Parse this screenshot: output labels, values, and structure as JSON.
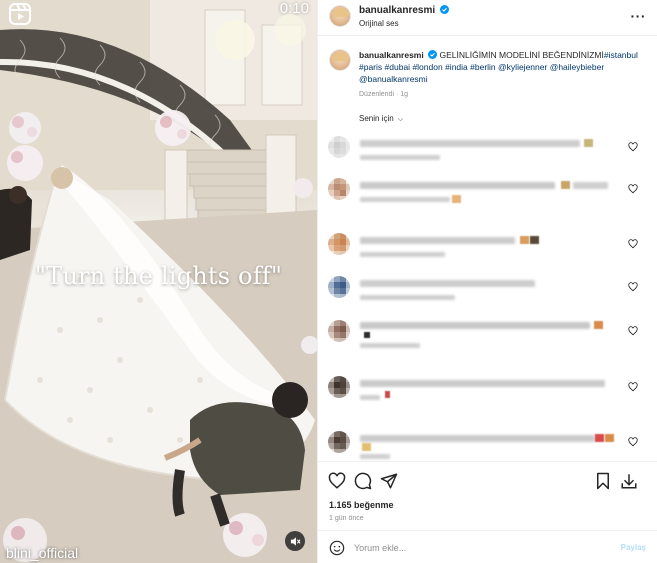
{
  "video": {
    "timer": "0:10",
    "overlay_caption": "\"Turn the lights off\"",
    "watermark": "blini_official",
    "icons": {
      "reels": "reels-icon",
      "mute": "speaker-muted-icon"
    }
  },
  "post_header": {
    "username": "banualkanresmi",
    "verified": true,
    "subtitle": "Orijinal ses",
    "more_icon": "more-horizontal-icon"
  },
  "caption": {
    "username": "banualkanresmi",
    "text": "GELİNLİĞİMİN MODELİNİ BEĞENDİNİZMİ",
    "hashtags": [
      "#istanbul",
      "#paris",
      "#dubai",
      "#london",
      "#india",
      "#berlin"
    ],
    "mentions": [
      "@kyliejenner",
      "@haileybieber",
      "@banualkanresmi"
    ],
    "time": "Düzenlendi · 1g"
  },
  "comment_filter": {
    "label": "Senin için"
  },
  "actions": {
    "like_icon": "heart-icon",
    "comment_icon": "comment-icon",
    "share_icon": "send-icon",
    "save_icon": "bookmark-icon",
    "download_icon": "download-icon"
  },
  "likes": "1.165 beğenme",
  "posted_ago": "1 gün önce",
  "add_comment": {
    "placeholder": "Yorum ekle...",
    "post_label": "Paylaş",
    "emoji_icon": "smiley-icon"
  },
  "colors": {
    "link": "#00376b",
    "verified": "#0095f6",
    "post_disabled": "#b2dffc"
  }
}
